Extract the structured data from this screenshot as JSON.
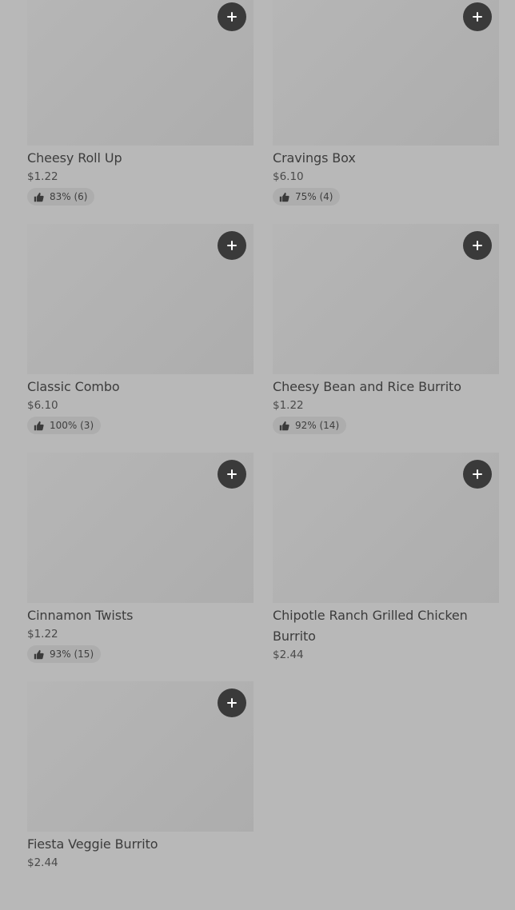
{
  "items": [
    {
      "name": "Cheesy Roll Up",
      "price": "$1.22",
      "rating": "83% (6)"
    },
    {
      "name": "Cravings Box",
      "price": "$6.10",
      "rating": "75% (4)"
    },
    {
      "name": "Classic Combo",
      "price": "$6.10",
      "rating": "100% (3)"
    },
    {
      "name": "Cheesy Bean and Rice Burrito",
      "price": "$1.22",
      "rating": "92% (14)"
    },
    {
      "name": "Cinnamon Twists",
      "price": "$1.22",
      "rating": "93% (15)"
    },
    {
      "name": "Chipotle Ranch Grilled Chicken Burrito",
      "price": "$2.44",
      "rating": null
    },
    {
      "name": "Fiesta Veggie Burrito",
      "price": "$2.44",
      "rating": null
    }
  ],
  "icons": {
    "add": "plus-icon",
    "rating": "thumbs-up-icon"
  },
  "colors": {
    "background": "#b8b8b8",
    "button": "#3a3a3a",
    "text": "#3c3c3c"
  }
}
